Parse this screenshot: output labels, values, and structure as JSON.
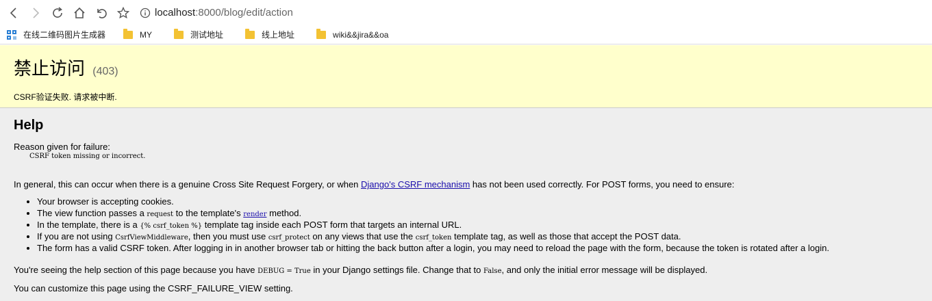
{
  "browser": {
    "url_host": "localhost",
    "url_rest": ":8000/blog/edit/action",
    "bookmarks": [
      {
        "label": "在线二维码图片生成器",
        "icon": "qr-app-icon"
      },
      {
        "label": "MY",
        "icon": "folder-icon"
      },
      {
        "label": "测试地址",
        "icon": "folder-icon"
      },
      {
        "label": "线上地址",
        "icon": "folder-icon"
      },
      {
        "label": "wiki&&jira&&oa",
        "icon": "folder-icon"
      }
    ],
    "colors": {
      "bookmark_folder": "#f3c233",
      "link": "#1a0dab"
    }
  },
  "summary": {
    "title": "禁止访问",
    "status_code": "(403)",
    "message": "CSRF验证失败. 请求被中断.",
    "background": "#ffffcc"
  },
  "help": {
    "heading": "Help",
    "reason_label": "Reason given for failure:",
    "reason": "CSRF token missing or incorrect.",
    "general_before": "In general, this can occur when there is a genuine Cross Site Request Forgery, or when ",
    "general_link": "Django's CSRF mechanism",
    "general_after": " has not been used correctly. For POST forms, you need to ensure:",
    "items": {
      "i1": "Your browser is accepting cookies.",
      "i2_a": "The view function passes a ",
      "i2_code": "request",
      "i2_b": " to the template's ",
      "i2_link": "render",
      "i2_c": " method.",
      "i3_a": "In the template, there is a ",
      "i3_code": "{% csrf_token %}",
      "i3_b": " template tag inside each POST form that targets an internal URL.",
      "i4_a": "If you are not using ",
      "i4_code1": "CsrfViewMiddleware",
      "i4_b": ", then you must use ",
      "i4_code2": "csrf_protect",
      "i4_c": " on any views that use the ",
      "i4_code3": "csrf_token",
      "i4_d": " template tag, as well as those that accept the POST data.",
      "i5": "The form has a valid CSRF token. After logging in in another browser tab or hitting the back button after a login, you may need to reload the page with the form, because the token is rotated after a login."
    },
    "debug_a": "You're seeing the help section of this page because you have ",
    "debug_code1": "DEBUG = True",
    "debug_b": " in your Django settings file. Change that to ",
    "debug_code2": "False",
    "debug_c": ", and only the initial error message will be displayed.",
    "customize": "You can customize this page using the CSRF_FAILURE_VIEW setting."
  }
}
